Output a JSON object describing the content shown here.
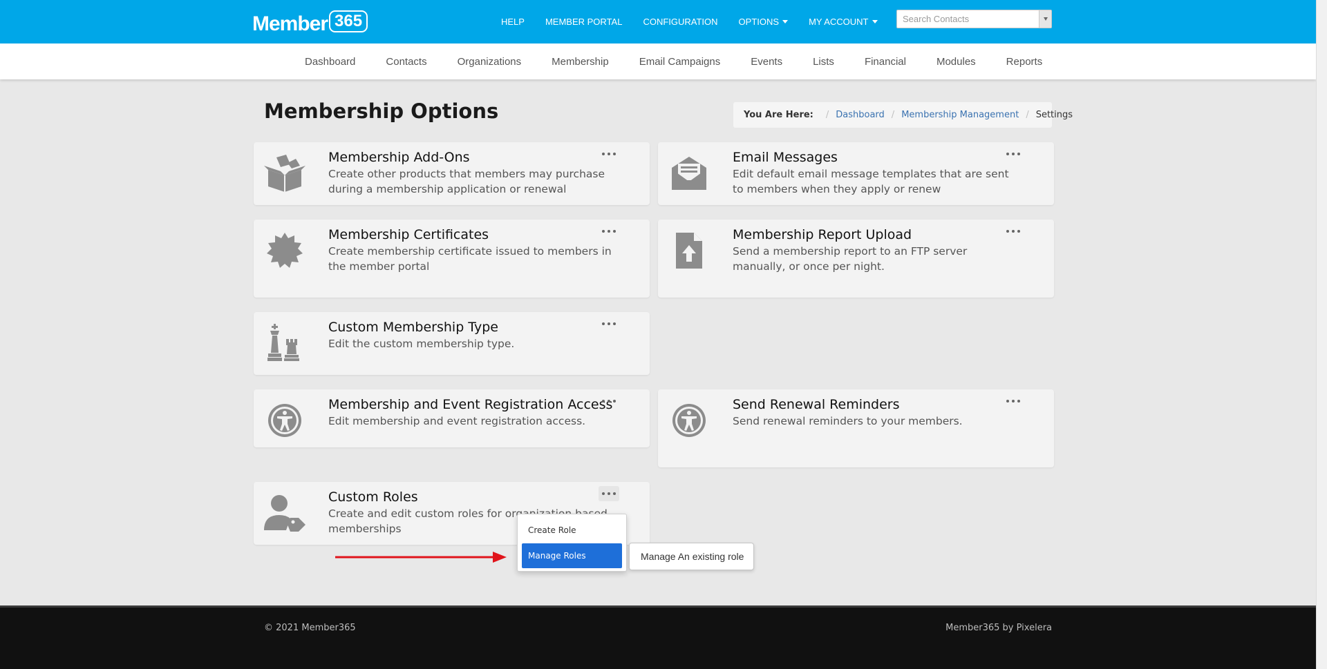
{
  "brand": {
    "logo_text": "Member",
    "logo_badge": "365"
  },
  "topnav": {
    "help": "HELP",
    "member_portal": "MEMBER PORTAL",
    "configuration": "CONFIGURATION",
    "options": "OPTIONS",
    "my_account": "MY ACCOUNT"
  },
  "search": {
    "placeholder": "Search Contacts"
  },
  "mainnav": [
    "Dashboard",
    "Contacts",
    "Organizations",
    "Membership",
    "Email Campaigns",
    "Events",
    "Lists",
    "Financial",
    "Modules",
    "Reports"
  ],
  "page": {
    "title": "Membership Options"
  },
  "breadcrumb": {
    "label": "You Are Here:",
    "items": [
      "Dashboard",
      "Membership Management",
      "Settings"
    ]
  },
  "cards": [
    {
      "title": "Membership Add-Ons",
      "desc": "Create other products that members may purchase during a membership application or renewal",
      "icon": "open-box-icon"
    },
    {
      "title": "Email Messages",
      "desc": "Edit default email message templates that are sent to members when they apply or renew",
      "icon": "envelope-open-icon"
    },
    {
      "title": "Membership Certificates",
      "desc": "Create membership certificate issued to members in the member portal",
      "icon": "certificate-icon"
    },
    {
      "title": "Membership Report Upload",
      "desc": "Send a membership report to an FTP server manually, or once per night.",
      "icon": "file-upload-icon"
    },
    {
      "title": "Custom Membership Type",
      "desc": "Edit the custom membership type.",
      "icon": "chess-pieces-icon"
    },
    {
      "title": "Membership and Event Registration Access",
      "desc": "Edit membership and event registration access.",
      "icon": "universal-access-icon"
    },
    {
      "title": "Send Renewal Reminders",
      "desc": "Send renewal reminders to your members.",
      "icon": "universal-access-icon"
    },
    {
      "title": "Custom Roles",
      "desc": "Create and edit custom roles for organization based memberships",
      "icon": "user-tag-icon"
    }
  ],
  "menu": {
    "items": [
      "Create Role",
      "Manage Roles"
    ],
    "tooltip": "Manage An existing role"
  },
  "footer": {
    "copyright": "© 2021 Member365",
    "credit": "Member365 by Pixelera"
  },
  "colors": {
    "topbar": "#00a7e8",
    "highlight": "#1e6fd9",
    "arrow": "#e0141b",
    "footer": "#111111"
  }
}
